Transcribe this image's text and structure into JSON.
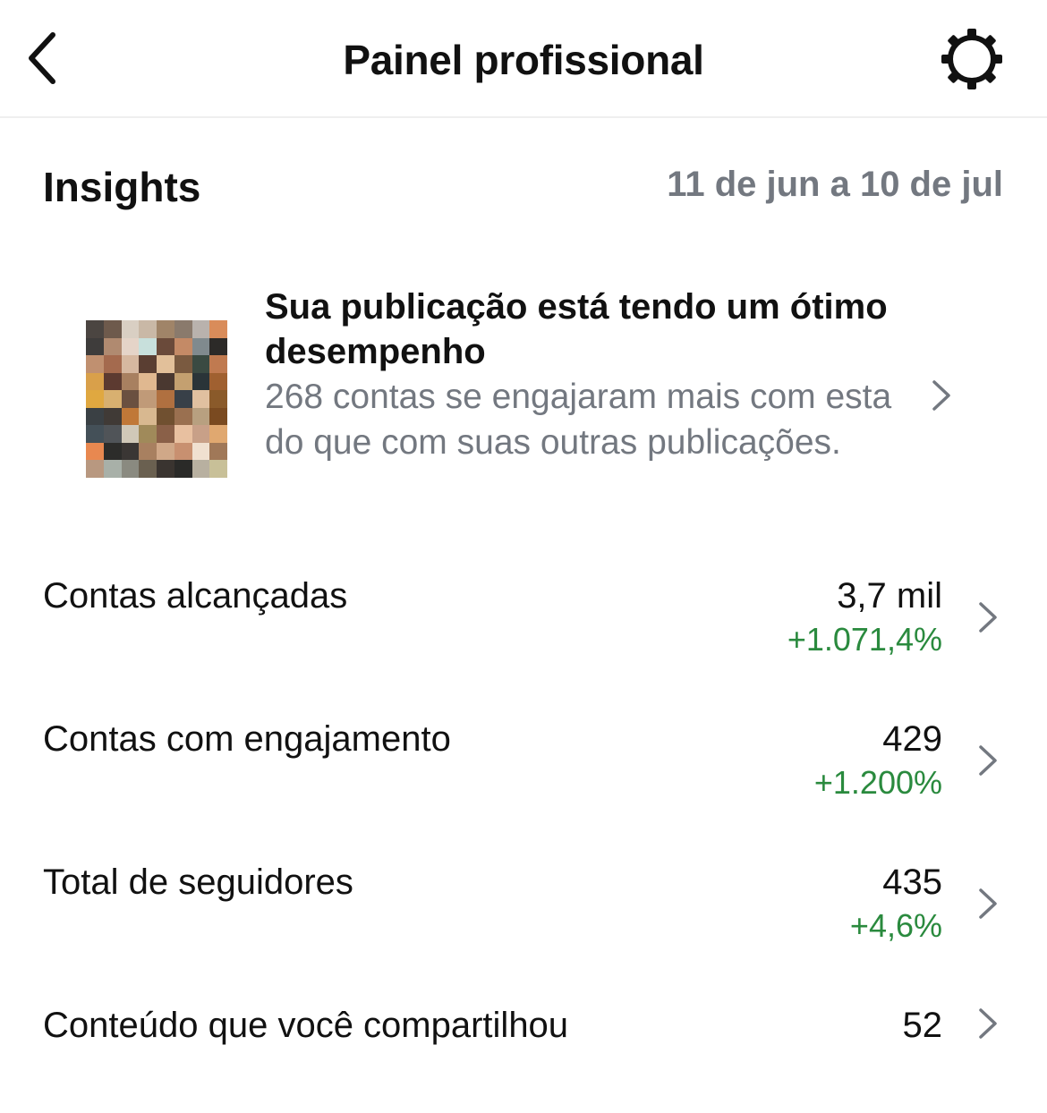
{
  "header": {
    "title": "Painel profissional",
    "back_icon": "chevron-left-icon",
    "settings_icon": "gear-icon"
  },
  "insights": {
    "title": "Insights",
    "date_range": "11 de jun a 10 de jul"
  },
  "highlight": {
    "title": "Sua publicação está tendo um ótimo desempenho",
    "description": "268 contas se engajaram mais com esta do que com suas outras publicações.",
    "thumbnail_icon": "post-thumbnail"
  },
  "metrics": [
    {
      "label": "Contas alcançadas",
      "value": "3,7 mil",
      "change": "+1.071,4%"
    },
    {
      "label": "Contas com engajamento",
      "value": "429",
      "change": "+1.200%"
    },
    {
      "label": "Total de seguidores",
      "value": "435",
      "change": "+4,6%"
    },
    {
      "label": "Conteúdo que você compartilhou",
      "value": "52",
      "change": ""
    }
  ],
  "colors": {
    "positive_change": "#2a8a3e",
    "secondary_text": "#737880",
    "divider": "#efefef"
  }
}
